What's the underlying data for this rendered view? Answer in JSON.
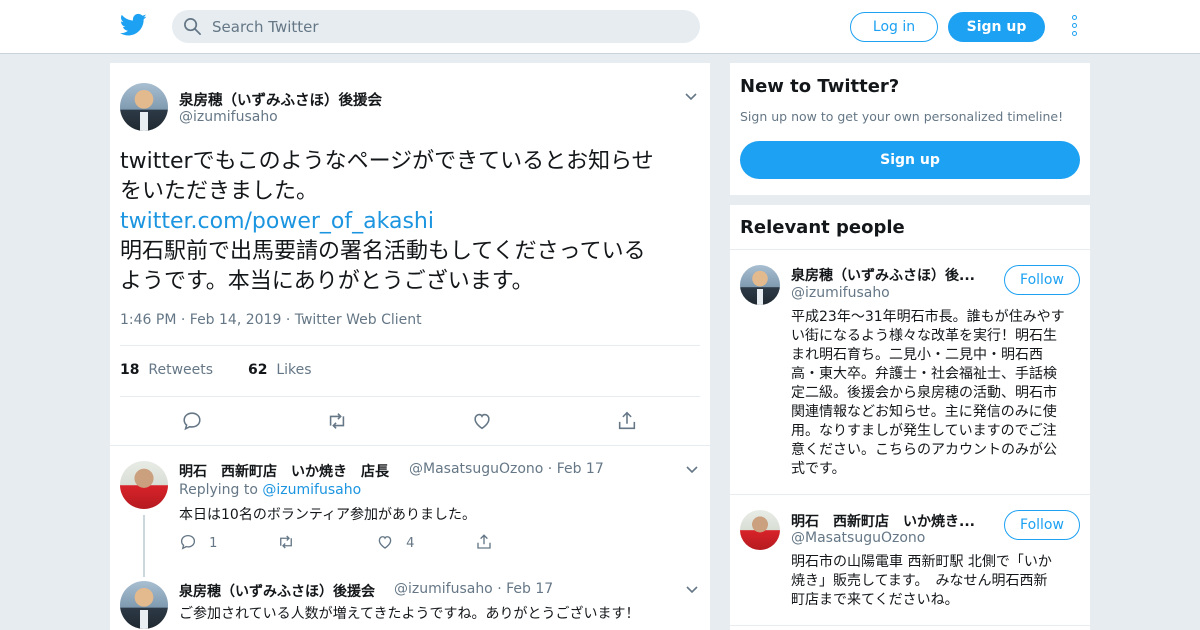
{
  "topbar": {
    "logo_icon": "twitter-bird-icon",
    "search_placeholder": "Search Twitter",
    "login_label": "Log in",
    "signup_label": "Sign up",
    "more_icon": "more-vertical-icon",
    "accent": "#1da1f2"
  },
  "tweet": {
    "author_name": "泉房穂（いずみふさほ）後援会",
    "author_handle": "@izumifusaho",
    "text_line1": "twitterでもこのようなページができているとお知らせ",
    "text_line2": "をいただきました。",
    "link": "twitter.com/power_of_akashi",
    "text_line3": "明石駅前で出馬要請の署名活動もしてくださっている",
    "text_line4": "ようです。本当にありがとうございます。",
    "time": "1:46 PM",
    "date": "Feb 14, 2019",
    "client": "Twitter Web Client",
    "dot": "·",
    "retweets_count": "18",
    "retweets_label": "Retweets",
    "likes_count": "62",
    "likes_label": "Likes"
  },
  "replies": [
    {
      "author_name": "明石　西新町店　いか焼き　店長",
      "author_handle": "@MasatsuguOzono",
      "date": "Feb 17",
      "replying_prefix": "Replying to",
      "replying_handle": "@izumifusaho",
      "text": "本日は10名のボランティア参加がありました。",
      "reply_count": "1",
      "retweet_count": "",
      "like_count": "4"
    },
    {
      "author_name": "泉房穂（いずみふさほ）後援会",
      "author_handle": "@izumifusaho",
      "date": "Feb 17",
      "text": "ご参加されている人数が増えてきたようですね。ありがとうございます！"
    }
  ],
  "sidebar": {
    "new_title": "New to Twitter?",
    "new_sub": "Sign up now to get your own personalized timeline!",
    "signup_label": "Sign up",
    "relevant_title": "Relevant people",
    "people": [
      {
        "name": "泉房穂（いずみふさほ）後...",
        "handle": "@izumifusaho",
        "follow_label": "Follow",
        "bio": [
          "平成23年〜31年明石市長。誰もが住みやす",
          "い街になるよう様々な改革を実行！明石生",
          "まれ明石育ち。二見小・二見中・明石西",
          "高・東大卒。弁護士・社会福祉士、手話検",
          "定二級。後援会から泉房穂の活動、明石市",
          "関連情報などお知らせ。主に発信のみに使",
          "用。なりすましが発生していますのでご注",
          "意ください。こちらのアカウントのみが公",
          "式です。"
        ]
      },
      {
        "name": "明石　西新町店　いか焼き...",
        "handle": "@MasatsuguOzono",
        "follow_label": "Follow",
        "bio": [
          "明石市の山陽電車 西新町駅 北側で「いか",
          "焼き」販売してます。　みなせん明石西新",
          "町店まで来てくださいね。"
        ]
      }
    ]
  }
}
